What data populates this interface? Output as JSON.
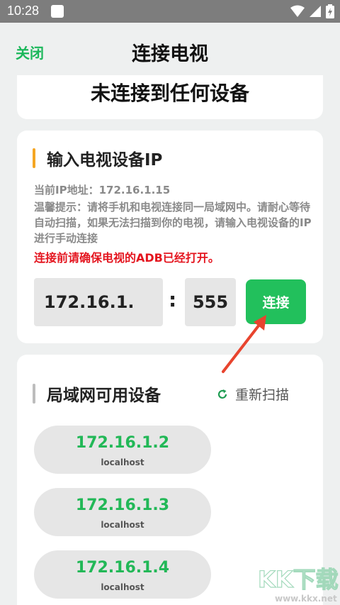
{
  "status_bar": {
    "time": "10:28"
  },
  "header": {
    "close_label": "关闭",
    "title": "连接电视"
  },
  "connection_status": "未连接到任何设备",
  "manual": {
    "section_title": "输入电视设备IP",
    "current_ip": "当前IP地址：172.16.1.15",
    "tip": "温馨提示：请将手机和电视连接同一局域网中。请耐心等待自动扫描，如果无法扫描到你的电视，请输入电视设备的IP进行手动连接",
    "warning": "连接前请确保电视的ADB已经打开。",
    "ip_value": "172.16.1.",
    "separator": ":",
    "port_value": "555",
    "connect_label": "连接"
  },
  "lan": {
    "section_title": "局域网可用设备",
    "rescan_label": "重新扫描",
    "devices": [
      {
        "ip": "172.16.1.2",
        "host": "localhost"
      },
      {
        "ip": "172.16.1.3",
        "host": "localhost"
      },
      {
        "ip": "172.16.1.4",
        "host": "localhost"
      }
    ]
  },
  "watermark": {
    "logo_text": "KK下载",
    "url": "www.kkx.net"
  },
  "colors": {
    "accent_green": "#22c05c",
    "warning_red": "#e4141e",
    "section_bar_orange": "#f5a623",
    "arrow_red": "#e8442e"
  },
  "icons": [
    "notification-icon",
    "wifi-icon",
    "signal-icon",
    "battery-icon",
    "refresh-icon",
    "arrow-annotation"
  ]
}
